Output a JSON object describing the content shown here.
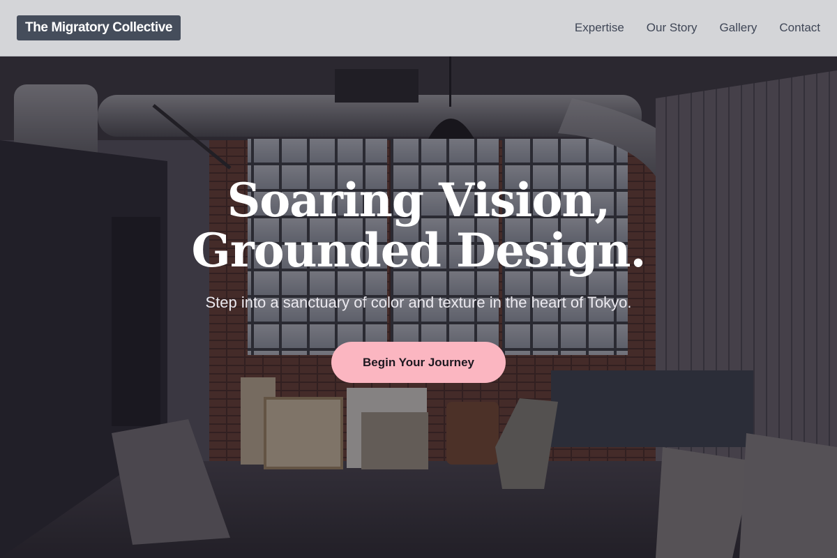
{
  "header": {
    "logo": "The Migratory Collective",
    "nav": [
      "Expertise",
      "Our Story",
      "Gallery",
      "Contact"
    ]
  },
  "hero": {
    "headline_line1": "Soaring Vision,",
    "headline_line2": "Grounded Design.",
    "subtitle": "Step into a sanctuary of color and texture in the heart of Tokyo.",
    "cta_label": "Begin Your Journey",
    "background_photo": "Dimly lit art studio with industrial ducts, tall factory windows, chandeliers and stacked canvases"
  },
  "colors": {
    "header_bg": "#d4d5d8",
    "logo_bg": "#454d5b",
    "nav_text": "#3f4656",
    "cta_bg": "#fbb6c1",
    "cta_text": "#1d1820",
    "headline_text": "#ffffff"
  }
}
